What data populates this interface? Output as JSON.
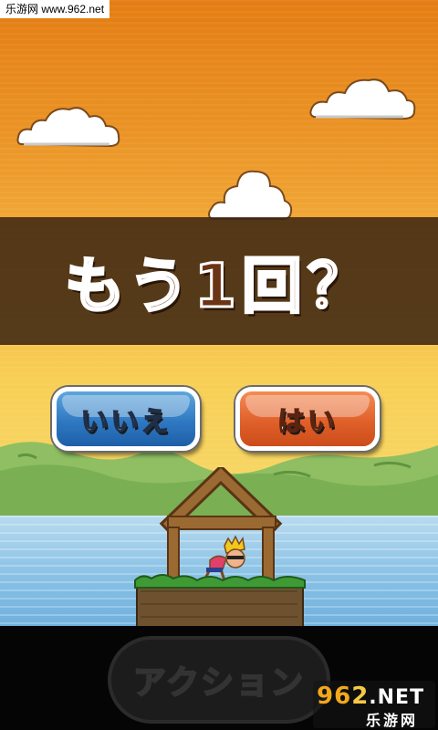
{
  "watermark": {
    "site_text": "乐游网 www.962.net",
    "logo_num_a": "96",
    "logo_num_b": "2",
    "logo_suffix": ".NET",
    "logo_sub": "乐游网"
  },
  "dialog": {
    "title": "もう1回？",
    "no_label": "いいえ",
    "yes_label": "はい"
  },
  "controls": {
    "action_label": "アクション"
  },
  "colors": {
    "sky_top": "#e47d14",
    "sky_bottom": "#f6d868",
    "banner": "#3a2412",
    "no_button": "#2f79c2",
    "yes_button": "#e0602a",
    "title_fill": "#6b3415"
  },
  "icons": {
    "character": "crowned-character-icon",
    "house": "wooden-frame-house"
  }
}
